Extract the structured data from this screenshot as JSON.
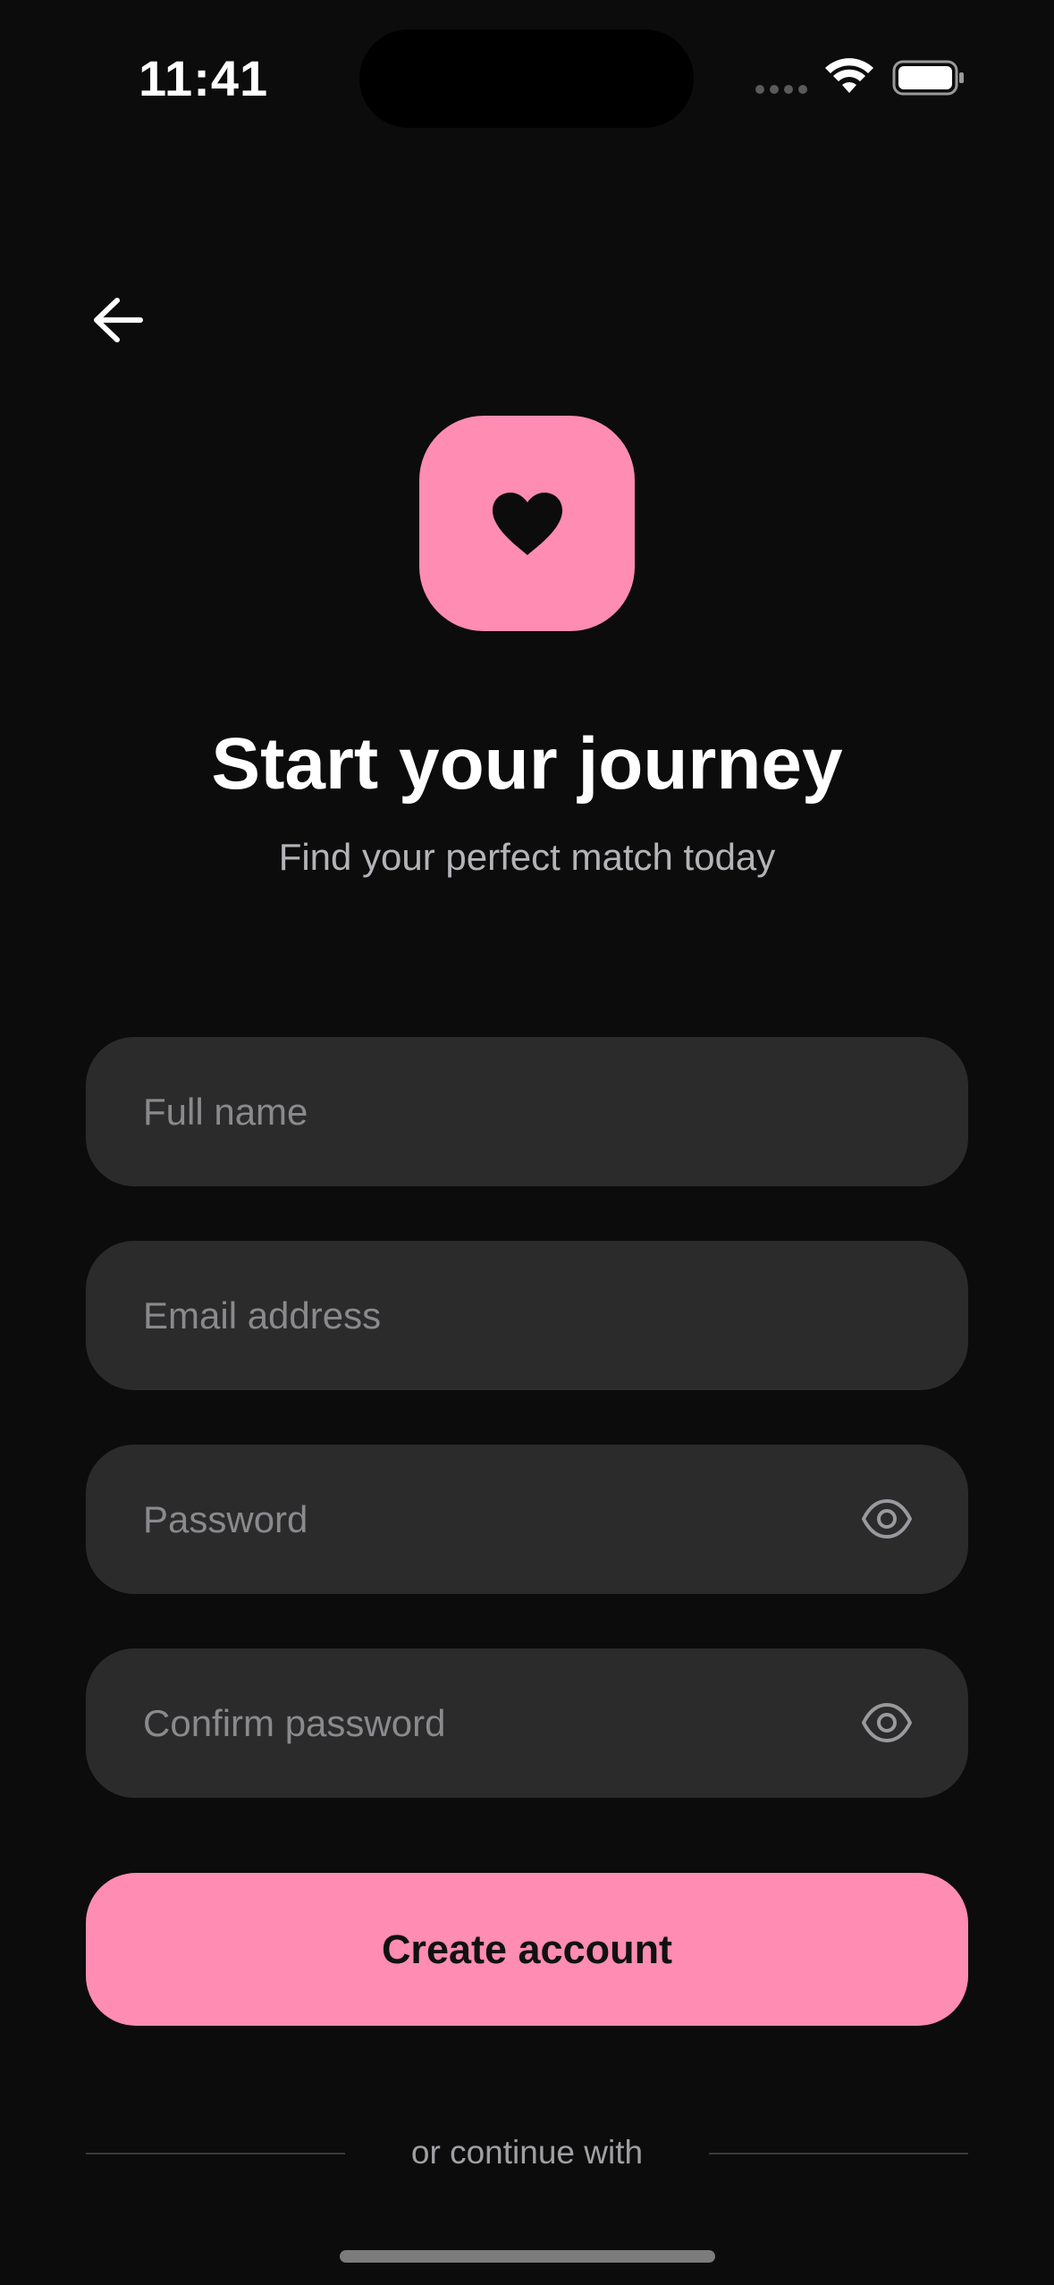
{
  "status_bar": {
    "time": "11:41"
  },
  "header": {
    "back_icon": "arrow-left-icon"
  },
  "logo": {
    "icon": "heart-icon",
    "tile_color": "#ff8cb2"
  },
  "hero": {
    "title": "Start your journey",
    "subtitle": "Find your perfect match today"
  },
  "form": {
    "full_name_placeholder": "Full name",
    "email_placeholder": "Email address",
    "password_placeholder": "Password",
    "confirm_password_placeholder": "Confirm password",
    "password_toggle_icon": "eye-icon",
    "submit_label": "Create account"
  },
  "social": {
    "divider_label": "or continue with"
  },
  "theme": {
    "accent": "#ff8cb2",
    "background": "#0c0c0c",
    "field_background": "#2b2b2b"
  }
}
